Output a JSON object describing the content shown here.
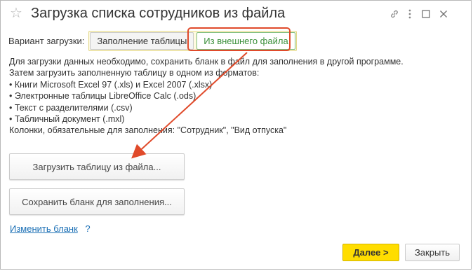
{
  "window": {
    "title": "Загрузка списка сотрудников из файла"
  },
  "variant": {
    "label": "Вариант загрузки:",
    "options": [
      "Заполнение таблицы",
      "Из внешнего файла"
    ],
    "selected": "Из внешнего файла"
  },
  "info": {
    "lines": [
      "Для загрузки данных необходимо, сохранить бланк в файл для заполнения в другой программе.",
      "Затем загрузить заполненную таблицу в одном из форматов:",
      "• Книги Microsoft Excel 97 (.xls) и Excel 2007 (.xlsx)",
      "• Электронные таблицы LibreOffice Calc (.ods)",
      "• Текст с разделителями (.csv)",
      "• Табличный документ (.mxl)",
      "Колонки, обязательные для заполнения: \"Сотрудник\", \"Вид отпуска\""
    ]
  },
  "actions": {
    "load_label": "Загрузить таблицу из файла...",
    "save_label": "Сохранить бланк для заполнения...",
    "change_label": "Изменить бланк",
    "help_label": "?"
  },
  "footer": {
    "next_label": "Далее >",
    "close_label": "Закрыть"
  },
  "colors": {
    "accent_button": "#ffdd00",
    "annotation": "#e04a2a",
    "link": "#1a6fb5",
    "selected_option": "#3a8f3a"
  }
}
